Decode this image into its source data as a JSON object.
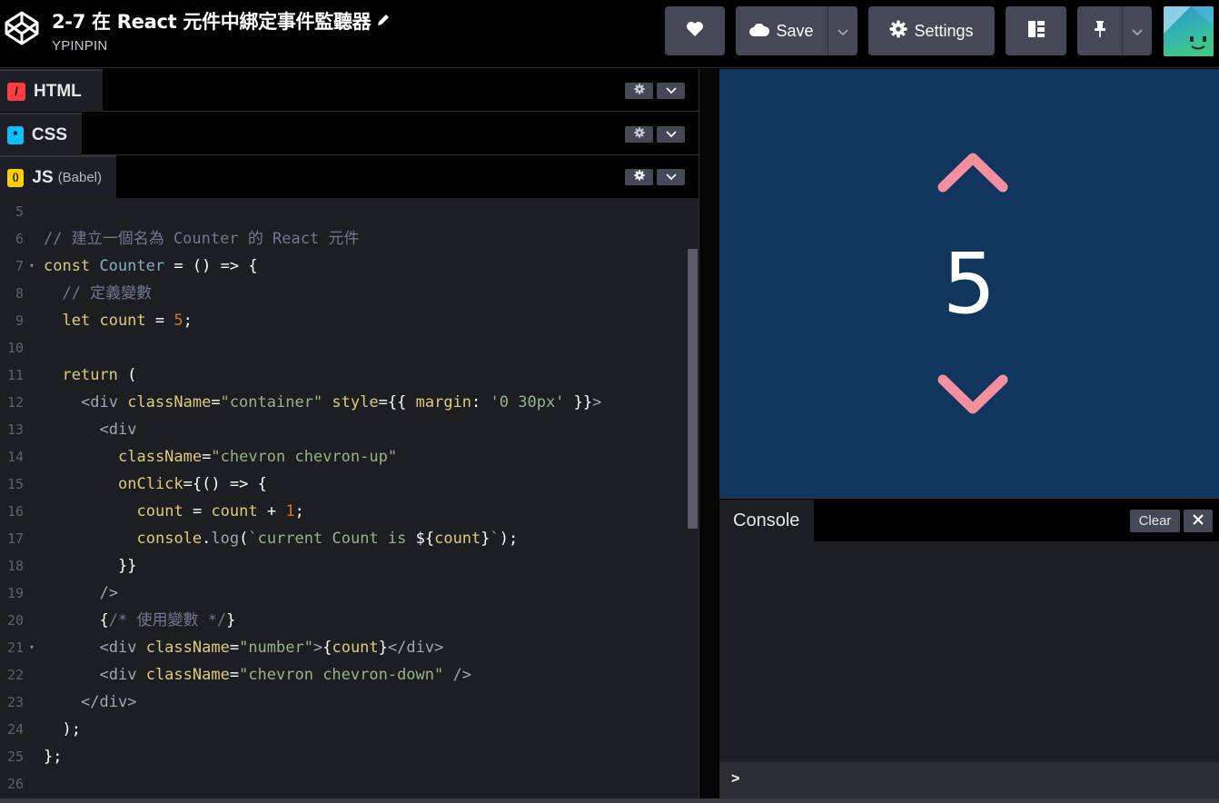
{
  "header": {
    "title": "2-7 在 React 元件中綁定事件監聽器",
    "author": "YPINPIN",
    "save_label": "Save",
    "settings_label": "Settings"
  },
  "panels": {
    "html": {
      "label": "HTML",
      "badge": "/",
      "color": "#ff3c41"
    },
    "css": {
      "label": "CSS",
      "badge": "*",
      "color": "#0ebeff"
    },
    "js": {
      "label": "JS",
      "sublabel": "(Babel)",
      "badge": "()",
      "color": "#fcd000"
    }
  },
  "code": {
    "line_numbers": [
      "5",
      "6",
      "7",
      "8",
      "9",
      "10",
      "11",
      "12",
      "13",
      "14",
      "15",
      "16",
      "17",
      "18",
      "19",
      "20",
      "21",
      "22",
      "23",
      "24",
      "25",
      "26"
    ],
    "lines": [
      "",
      "// 建立一個名為 Counter 的 React 元件",
      "const Counter = () => {",
      "  // 定義變數",
      "  let count = 5;",
      "",
      "  return (",
      "    <div className=\"container\" style={{ margin: '0 30px' }}>",
      "      <div",
      "        className=\"chevron chevron-up\"",
      "        onClick={() => {",
      "          count = count + 1;",
      "          console.log(`current Count is ${count}`);",
      "        }}",
      "      />",
      "      {/* 使用變數 */}",
      "      <div className=\"number\">{count}</div>",
      "      <div className=\"chevron chevron-down\" />",
      "    </div>",
      "  );",
      "};",
      ""
    ]
  },
  "result": {
    "count": "5",
    "chevron_color": "#f48fa0",
    "background": "#10365e"
  },
  "console": {
    "tab_label": "Console",
    "clear_label": "Clear",
    "prompt": ">"
  }
}
